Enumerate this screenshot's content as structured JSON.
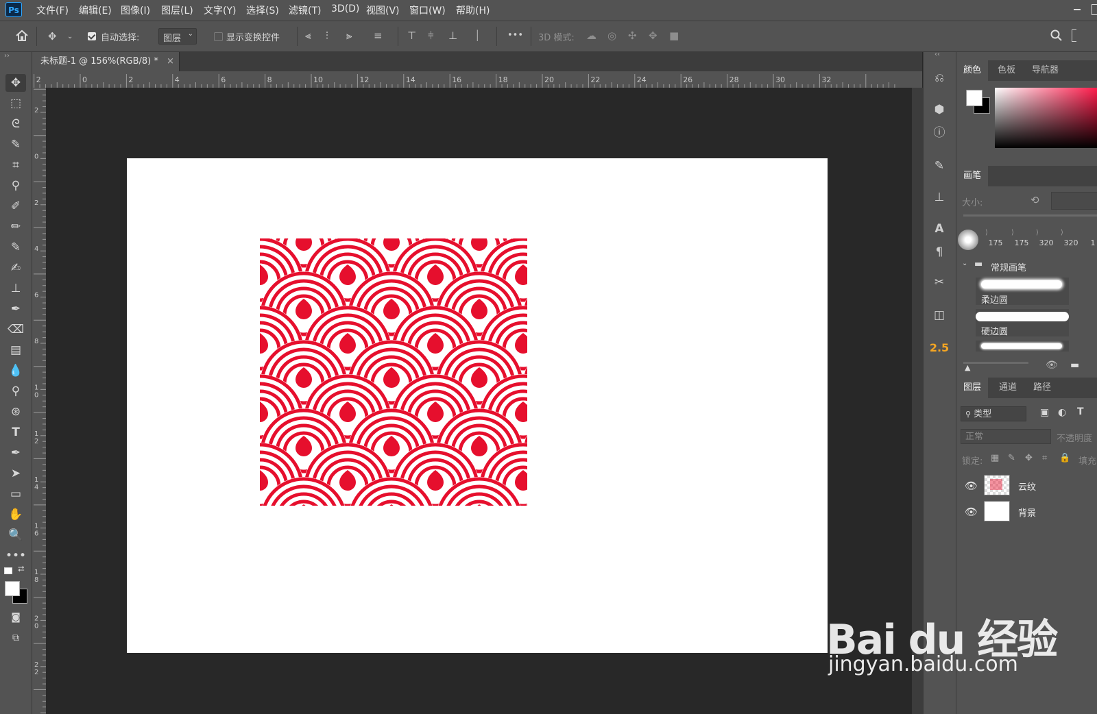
{
  "app": {
    "logo": "Ps"
  },
  "menu": [
    "文件(F)",
    "编辑(E)",
    "图像(I)",
    "图层(L)",
    "文字(Y)",
    "选择(S)",
    "滤镜(T)",
    "3D(D)",
    "视图(V)",
    "窗口(W)",
    "帮助(H)"
  ],
  "options": {
    "auto_select_label": "自动选择:",
    "auto_select_checked": true,
    "auto_select_target": "图层",
    "show_transform_label": "显示变换控件",
    "more": "•••",
    "mode_3d_label": "3D 模式:"
  },
  "document": {
    "tab_title": "未标题-1 @ 156%(RGB/8) *",
    "close": "×",
    "pattern_color": "#e60f2d"
  },
  "rulers": {
    "top_ticks": [
      "2",
      "0",
      "2",
      "4",
      "6",
      "8",
      "10",
      "12",
      "14",
      "16",
      "18",
      "20",
      "22",
      "24",
      "26",
      "28",
      "30",
      "32"
    ],
    "left_ticks": [
      "2",
      "0",
      "2",
      "4",
      "6",
      "8",
      "1 0",
      "1 2",
      "1 4",
      "1 6",
      "1 8",
      "2 0",
      "2 2"
    ]
  },
  "side_panel": {
    "value_badge": "2.5"
  },
  "color_panel": {
    "tabs": [
      "颜色",
      "色板",
      "导航器"
    ],
    "fg": "#ffffff",
    "bg": "#000000"
  },
  "brush_panel": {
    "tab": "画笔",
    "size_label": "大小:",
    "sizes": [
      "175",
      "175",
      "320",
      "320",
      "1"
    ],
    "group": "常规画笔",
    "presets": [
      "柔边圆",
      "硬边圆"
    ]
  },
  "layers_panel": {
    "tabs": [
      "图层",
      "通道",
      "路径"
    ],
    "filter": "类型",
    "blend_mode": "正常",
    "opacity_label": "不透明度",
    "lock_label": "锁定:",
    "fill_label": "填充",
    "layers": [
      {
        "name": "云纹",
        "visible": true
      },
      {
        "name": "背景",
        "visible": true
      }
    ]
  },
  "watermark": {
    "logo": "Bai du 经验",
    "url": "jingyan.baidu.com"
  }
}
